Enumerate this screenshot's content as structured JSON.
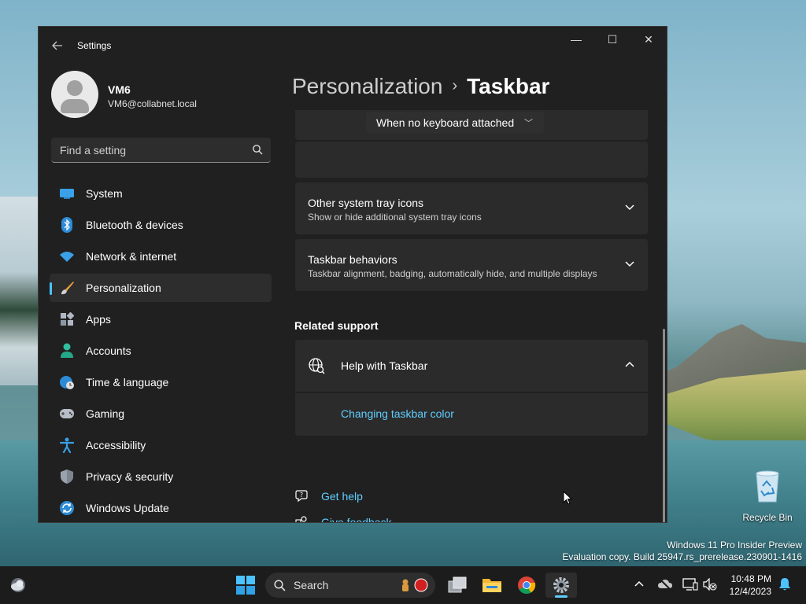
{
  "window": {
    "app_title": "Settings",
    "min_glyph": "—",
    "max_glyph": "☐",
    "close_glyph": "✕"
  },
  "user": {
    "name": "VM6",
    "email": "VM6@collabnet.local"
  },
  "search": {
    "placeholder": "Find a setting"
  },
  "nav": {
    "items": [
      {
        "label": "System",
        "icon": "monitor-icon"
      },
      {
        "label": "Bluetooth & devices",
        "icon": "bluetooth-icon"
      },
      {
        "label": "Network & internet",
        "icon": "wifi-icon"
      },
      {
        "label": "Personalization",
        "icon": "brush-icon",
        "active": true
      },
      {
        "label": "Apps",
        "icon": "apps-icon"
      },
      {
        "label": "Accounts",
        "icon": "person-icon"
      },
      {
        "label": "Time & language",
        "icon": "globe-clock-icon"
      },
      {
        "label": "Gaming",
        "icon": "gamepad-icon"
      },
      {
        "label": "Accessibility",
        "icon": "accessibility-icon"
      },
      {
        "label": "Privacy & security",
        "icon": "shield-icon"
      },
      {
        "label": "Windows Update",
        "icon": "update-icon"
      }
    ]
  },
  "breadcrumb": {
    "parent": "Personalization",
    "separator": "›",
    "current": "Taskbar"
  },
  "settings": {
    "keyboard_dropdown_value": "When no keyboard attached",
    "other_tray": {
      "title": "Other system tray icons",
      "subtitle": "Show or hide additional system tray icons"
    },
    "behaviors": {
      "title": "Taskbar behaviors",
      "subtitle": "Taskbar alignment, badging, automatically hide, and multiple displays"
    }
  },
  "related": {
    "section_title": "Related support",
    "help_title": "Help with Taskbar",
    "help_link": "Changing taskbar color"
  },
  "footer": {
    "get_help": "Get help",
    "give_feedback": "Give feedback"
  },
  "desktop": {
    "recycle_bin": "Recycle Bin",
    "watermark_line1": "Windows 11 Pro Insider Preview",
    "watermark_line2": "Evaluation copy. Build 25947.rs_prerelease.230901-1416"
  },
  "taskbar": {
    "search_label": "Search",
    "time": "10:48 PM",
    "date": "12/4/2023"
  },
  "colors": {
    "accent": "#60cdff",
    "window_bg": "#202020",
    "card_bg": "#2b2b2b"
  }
}
